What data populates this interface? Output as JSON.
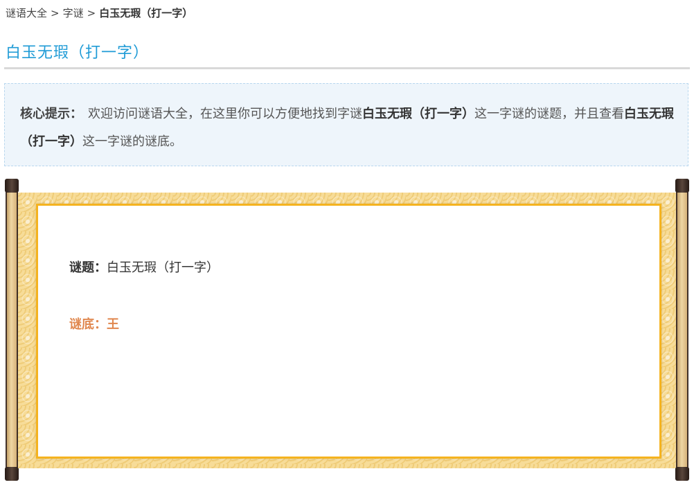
{
  "breadcrumb": {
    "items": [
      "谜语大全",
      "字谜"
    ],
    "separator": ">",
    "current": "白玉无瑕（打一字）"
  },
  "page": {
    "title": "白玉无瑕（打一字）"
  },
  "tip": {
    "label": "核心提示：",
    "text1": "欢迎访问谜语大全，在这里你可以方便地找到字谜",
    "bold1": "白玉无瑕（打一字）",
    "text2": "这一字谜的谜题，并且查看",
    "bold2": "白玉无瑕（打一字）",
    "text3": "这一字谜的谜底。"
  },
  "riddle": {
    "question_label": "谜题：",
    "question": "白玉无瑕（打一字）",
    "answer_label": "谜底：",
    "answer": "王"
  },
  "colors": {
    "title": "#1f9bd6",
    "answer": "#e0874e",
    "frame": "#f5b31f",
    "tip_bg": "#eef5fb"
  }
}
